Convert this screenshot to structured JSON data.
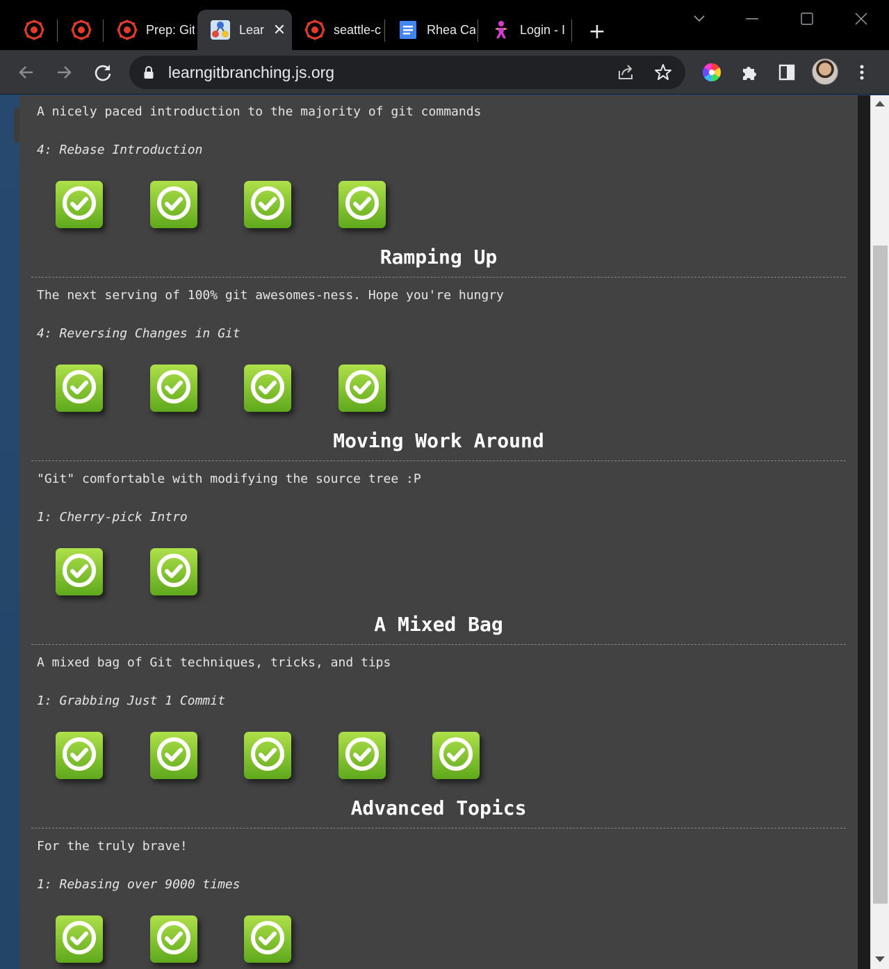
{
  "browser": {
    "tabs": [
      {
        "title": "",
        "icon": "canvas-icon"
      },
      {
        "title": "",
        "icon": "canvas-icon"
      },
      {
        "title": "Prep: Git",
        "icon": "canvas-icon"
      },
      {
        "title": "Lear",
        "icon": "learngitbranching-icon",
        "active": true
      },
      {
        "title": "seattle-c",
        "icon": "canvas-icon"
      },
      {
        "title": "Rhea Ca",
        "icon": "google-docs-icon"
      },
      {
        "title": "Login - I",
        "icon": "figure-icon"
      }
    ],
    "url": "learngitbranching.js.org"
  },
  "sections": [
    {
      "heading": "",
      "description": "A nicely paced introduction to the majority of git commands",
      "subtitle": "4: Rebase Introduction",
      "levels_completed": 4
    },
    {
      "heading": "Ramping Up",
      "description": "The next serving of 100% git awesomes-ness. Hope you're hungry",
      "subtitle": "4: Reversing Changes in Git",
      "levels_completed": 4
    },
    {
      "heading": "Moving Work Around",
      "description": "\"Git\" comfortable with modifying the source tree :P",
      "subtitle": "1: Cherry-pick Intro",
      "levels_completed": 2
    },
    {
      "heading": "A Mixed Bag",
      "description": "A mixed bag of Git techniques, tricks, and tips",
      "subtitle": "1: Grabbing Just 1 Commit",
      "levels_completed": 5
    },
    {
      "heading": "Advanced Topics",
      "description": "For the truly brave!",
      "subtitle": "1: Rebasing over 9000 times",
      "levels_completed": 3
    }
  ],
  "colors": {
    "panel_bg": "#424242",
    "level_complete_green": "#7cc22e",
    "page_bg": "#2d5684"
  }
}
